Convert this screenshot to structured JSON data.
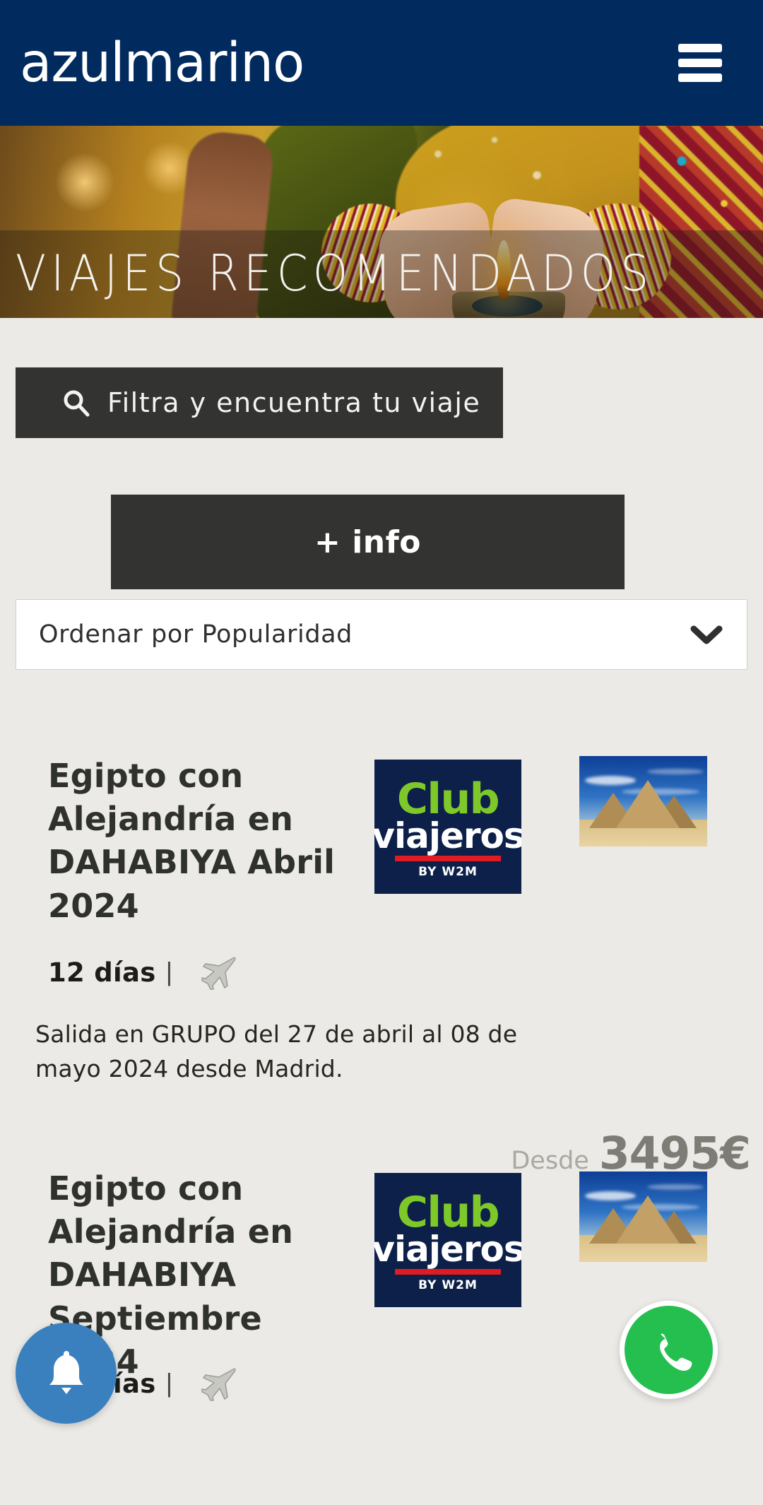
{
  "header": {
    "logo_text": "azulmarino",
    "menu_icon": "hamburger-icon",
    "brand_color": "#012a5e"
  },
  "hero": {
    "title": "VIAJES RECOMENDADOS",
    "image_description": "hands holding a lit oil lamp"
  },
  "filter": {
    "label": "Filtra y encuentra tu viaje",
    "icon": "search-icon",
    "background_color": "#333331"
  },
  "info_button": {
    "label": "+ info"
  },
  "sort": {
    "selected": "Ordenar por Popularidad",
    "icon": "chevron-down-icon"
  },
  "partner_logo": {
    "club_text": "Club",
    "viajeros_text": "viajeros",
    "by_text": "BY W2M",
    "green": "#7ec929",
    "navy": "#0d2049",
    "red": "#e01b22"
  },
  "products": [
    {
      "title": "Egipto con Alejandría en DAHABIYA Abril 2024",
      "days": "12 días",
      "separator": "|",
      "transport_icon": "airplane-icon",
      "description": "Salida en GRUPO  del 27 de abril al 08 de mayo 2024 desde Madrid.",
      "price_prefix": "Desde",
      "price": "3495€",
      "thumbnail": "pyramids-of-giza"
    },
    {
      "title": "Egipto con Alejandría en DAHABIYA Septiembre 2024",
      "days": "12 días",
      "separator": "|",
      "transport_icon": "airplane-icon",
      "thumbnail": "pyramids-of-giza"
    }
  ],
  "floating": {
    "notification_icon": "bell-icon",
    "notification_color": "#3a80bf",
    "whatsapp_icon": "whatsapp-icon",
    "whatsapp_color": "#25bf4f"
  }
}
